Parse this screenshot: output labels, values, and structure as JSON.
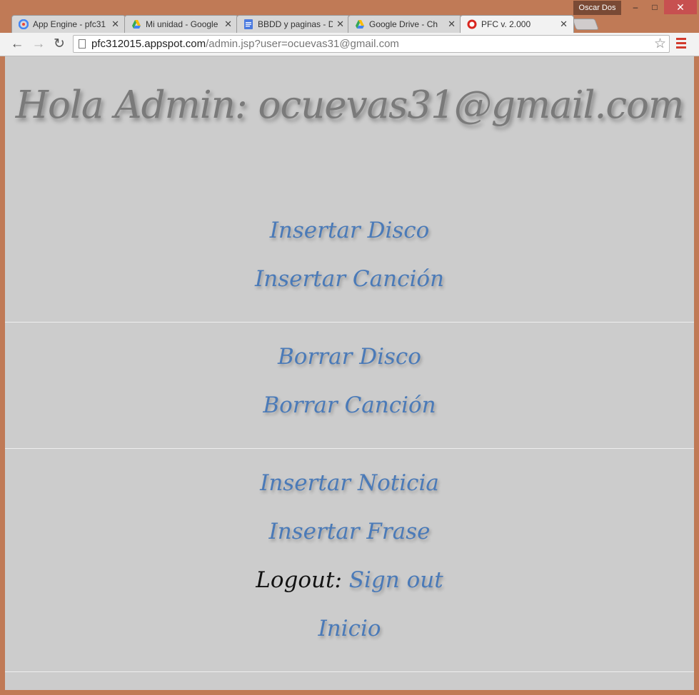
{
  "window": {
    "profile_name": "Oscar Dos",
    "minimize": "–",
    "maximize": "□",
    "close": "✕"
  },
  "tabs": [
    {
      "title": "App Engine - pfc31",
      "icon": "app-engine-icon",
      "close": "✕"
    },
    {
      "title": "Mi unidad - Google",
      "icon": "google-drive-icon",
      "close": "✕"
    },
    {
      "title": "BBDD y paginas - D",
      "icon": "google-docs-icon",
      "close": "✕"
    },
    {
      "title": "Google Drive - Ch",
      "icon": "google-drive-icon",
      "close": "✕"
    },
    {
      "title": "PFC v. 2.000",
      "icon": "pfc-icon",
      "close": "✕"
    }
  ],
  "toolbar": {
    "back": "←",
    "forward": "→",
    "reload": "↻",
    "url_host": "pfc312015.appspot.com",
    "url_path": "/admin.jsp?user=ocuevas31@gmail.com",
    "star": "☆"
  },
  "page": {
    "heading": "Hola Admin: ocuevas31@gmail.com",
    "links": {
      "insert_disc": "Insertar Disco",
      "insert_song": "Insertar Canción",
      "delete_disc": "Borrar Disco",
      "delete_song": "Borrar Canción",
      "insert_news": "Insertar Noticia",
      "insert_phrase": "Insertar Frase",
      "logout_label": "Logout:",
      "sign_out": "Sign out",
      "home": "Inicio"
    }
  }
}
